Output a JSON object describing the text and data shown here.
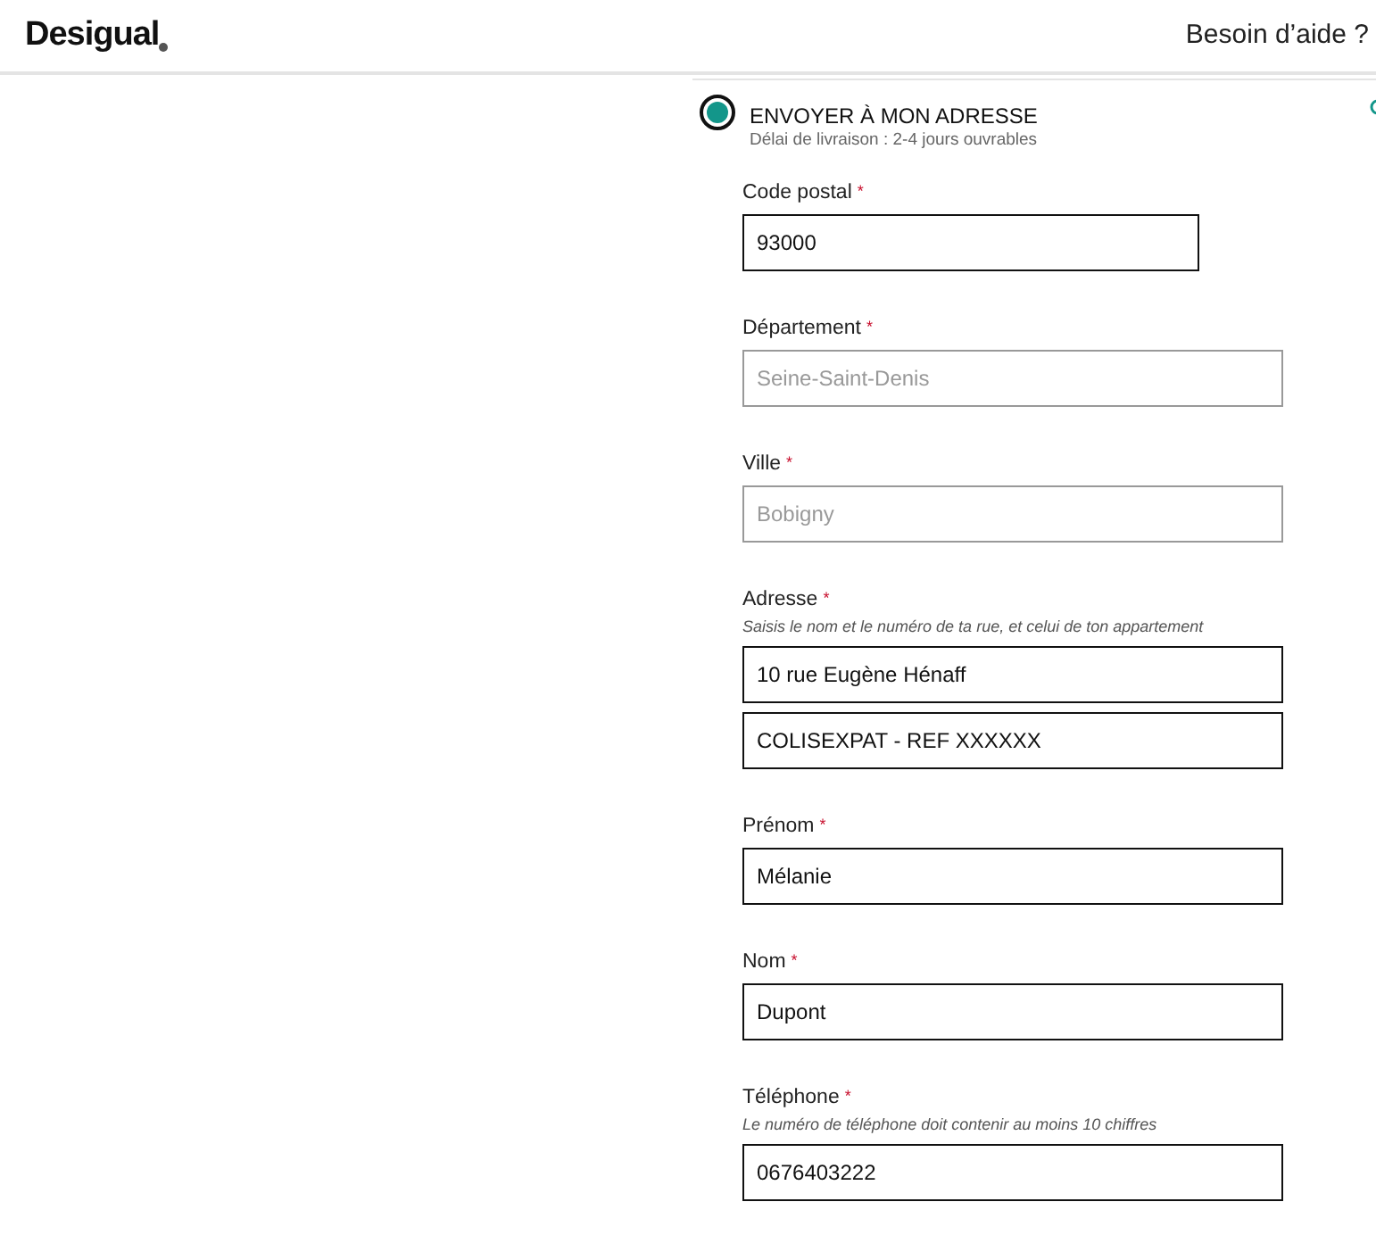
{
  "header": {
    "logo": "Desigual",
    "help": "Besoin d’aide ?"
  },
  "delivery_option": {
    "label": "ENVOYER À MON ADRESSE",
    "note": "Délai de livraison : 2-4 jours ouvrables",
    "selected": true
  },
  "fields": [
    {
      "label": "Code postal",
      "required_mark": "*",
      "kind": "short",
      "inputs": [
        {
          "value": "93000",
          "disabled": false
        }
      ]
    },
    {
      "label": "Département",
      "required_mark": "*",
      "kind": "full",
      "inputs": [
        {
          "value": "Seine-Saint-Denis",
          "disabled": true
        }
      ]
    },
    {
      "label": "Ville",
      "required_mark": "*",
      "kind": "full",
      "inputs": [
        {
          "value": "Bobigny",
          "disabled": true
        }
      ]
    },
    {
      "label": "Adresse",
      "required_mark": "*",
      "kind": "full",
      "hint": "Saisis le nom et le numéro de ta rue, et celui de ton appartement",
      "inputs": [
        {
          "value": "10 rue Eugène Hénaff",
          "disabled": false
        },
        {
          "value": "COLISEXPAT - REF XXXXXX",
          "disabled": false
        }
      ]
    },
    {
      "label": "Prénom",
      "required_mark": "*",
      "kind": "full",
      "inputs": [
        {
          "value": "Mélanie",
          "disabled": false
        }
      ]
    },
    {
      "label": "Nom",
      "required_mark": "*",
      "kind": "full",
      "inputs": [
        {
          "value": "Dupont",
          "disabled": false
        }
      ]
    },
    {
      "label": "Téléphone",
      "required_mark": "*",
      "kind": "full",
      "hint": "Le numéro de téléphone doit contenir au moins 10 chiffres",
      "inputs": [
        {
          "value": "0676403222",
          "disabled": false
        }
      ]
    }
  ]
}
